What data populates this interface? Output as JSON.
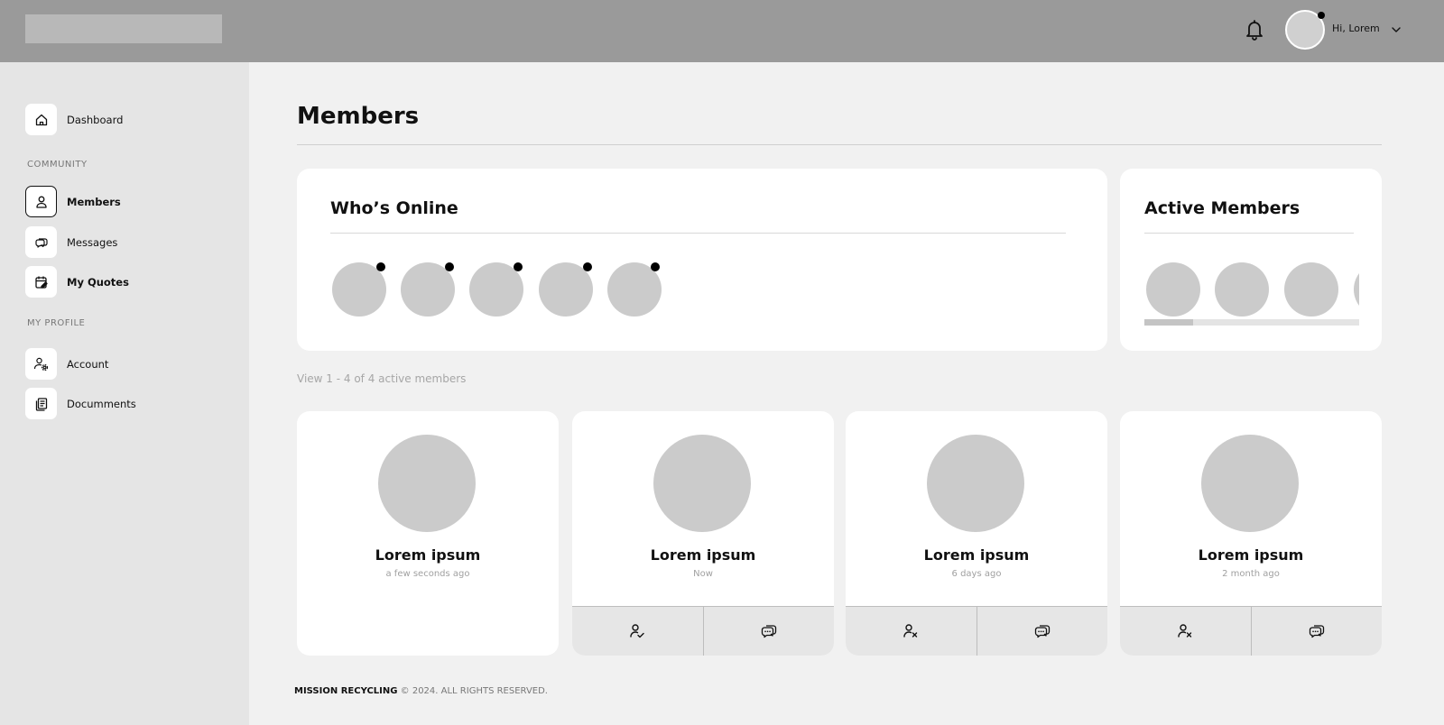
{
  "header": {
    "greeting": "Hi, Lorem",
    "icons": [
      "bell-icon",
      "chevron-down-icon"
    ]
  },
  "sidebar": {
    "dashboard": {
      "label": "Dashboard",
      "icon": "home-icon"
    },
    "community_heading": "COMMUNITY",
    "members": {
      "label": "Members",
      "icon": "user-icon",
      "active": true
    },
    "messages": {
      "label": "Messages",
      "icon": "chat-icon"
    },
    "quotes": {
      "label": "My Quotes",
      "icon": "calendar-edit-icon"
    },
    "profile_heading": "MY PROFILE",
    "account": {
      "label": "Account",
      "icon": "user-settings-icon"
    },
    "documents": {
      "label": "Documments",
      "icon": "documents-icon"
    }
  },
  "main": {
    "title": "Members",
    "whos_online": {
      "title": "Who’s Online",
      "online_count": 5
    },
    "active_members": {
      "title": "Active Members",
      "visible_count": 4,
      "scroll_position": 0.22
    },
    "view_info": "View 1 - 4 of 4 active members",
    "members": [
      {
        "name": "Lorem ipsum",
        "time": "a few seconds ago",
        "actions": []
      },
      {
        "name": "Lorem ipsum",
        "time": "Now",
        "actions": [
          "user-check-icon",
          "chat-icon"
        ]
      },
      {
        "name": "Lorem ipsum",
        "time": "6 days ago",
        "actions": [
          "user-remove-icon",
          "chat-icon"
        ]
      },
      {
        "name": "Lorem ipsum",
        "time": "2 month ago",
        "actions": [
          "user-remove-icon",
          "chat-icon"
        ]
      }
    ]
  },
  "footer": {
    "brand": "MISSION RECYCLING",
    "copyright": "© 2024. ALL RIGHTS RESERVED."
  },
  "colors": {
    "topbar": "#9a9a9a",
    "sidebar": "#e5e5e5",
    "page_bg": "#f1f1f1",
    "placeholder": "#cbcbcb",
    "online_dot": "#000000"
  }
}
